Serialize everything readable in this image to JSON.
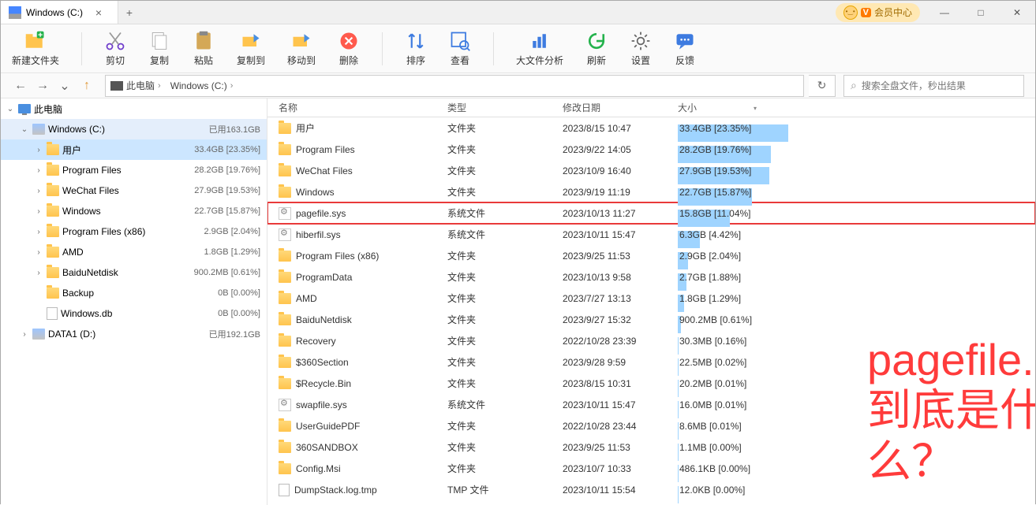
{
  "title": {
    "tab_label": "Windows (C:)"
  },
  "vip": {
    "text": "会员中心"
  },
  "toolbar": {
    "newfolder": "新建文件夹",
    "cut": "剪切",
    "copy": "复制",
    "paste": "粘贴",
    "copyto": "复制到",
    "moveto": "移动到",
    "delete": "删除",
    "sort": "排序",
    "view": "查看",
    "bigfile": "大文件分析",
    "refresh": "刷新",
    "settings": "设置",
    "feedback": "反馈"
  },
  "breadcrumb": {
    "root": "此电脑",
    "drive": "Windows (C:)"
  },
  "search": {
    "placeholder": "搜索全盘文件，秒出结果"
  },
  "tree": [
    {
      "level": 0,
      "chevron": "v",
      "icon": "pc",
      "label": "此电脑",
      "size": "",
      "sel": ""
    },
    {
      "level": 1,
      "chevron": "v",
      "icon": "drive",
      "label": "Windows (C:)",
      "size": "已用163.1GB",
      "sel": "alt"
    },
    {
      "level": 2,
      "chevron": ">",
      "icon": "folder",
      "label": "用户",
      "size": "33.4GB [23.35%]",
      "sel": "yes"
    },
    {
      "level": 2,
      "chevron": ">",
      "icon": "folder",
      "label": "Program Files",
      "size": "28.2GB [19.76%]",
      "sel": ""
    },
    {
      "level": 2,
      "chevron": ">",
      "icon": "folder",
      "label": "WeChat Files",
      "size": "27.9GB [19.53%]",
      "sel": ""
    },
    {
      "level": 2,
      "chevron": ">",
      "icon": "folder",
      "label": "Windows",
      "size": "22.7GB [15.87%]",
      "sel": ""
    },
    {
      "level": 2,
      "chevron": ">",
      "icon": "folder",
      "label": "Program Files (x86)",
      "size": "2.9GB [2.04%]",
      "sel": ""
    },
    {
      "level": 2,
      "chevron": ">",
      "icon": "folder",
      "label": "AMD",
      "size": "1.8GB [1.29%]",
      "sel": ""
    },
    {
      "level": 2,
      "chevron": ">",
      "icon": "folder",
      "label": "BaiduNetdisk",
      "size": "900.2MB [0.61%]",
      "sel": ""
    },
    {
      "level": 2,
      "chevron": "",
      "icon": "folder",
      "label": "Backup",
      "size": "0B [0.00%]",
      "sel": ""
    },
    {
      "level": 2,
      "chevron": "",
      "icon": "file",
      "label": "Windows.db",
      "size": "0B [0.00%]",
      "sel": ""
    },
    {
      "level": 1,
      "chevron": ">",
      "icon": "drive",
      "label": "DATA1 (D:)",
      "size": "已用192.1GB",
      "sel": ""
    }
  ],
  "columns": {
    "name": "名称",
    "type": "类型",
    "date": "修改日期",
    "size": "大小"
  },
  "files": [
    {
      "icon": "folder",
      "name": "用户",
      "type": "文件夹",
      "date": "2023/8/15 10:47",
      "size": "33.4GB [23.35%]",
      "bar": 100,
      "hl": false
    },
    {
      "icon": "folder",
      "name": "Program Files",
      "type": "文件夹",
      "date": "2023/9/22 14:05",
      "size": "28.2GB [19.76%]",
      "bar": 84,
      "hl": false
    },
    {
      "icon": "folder",
      "name": "WeChat Files",
      "type": "文件夹",
      "date": "2023/10/9 16:40",
      "size": "27.9GB [19.53%]",
      "bar": 83,
      "hl": false
    },
    {
      "icon": "folder",
      "name": "Windows",
      "type": "文件夹",
      "date": "2023/9/19 11:19",
      "size": "22.7GB [15.87%]",
      "bar": 67,
      "hl": false
    },
    {
      "icon": "sys",
      "name": "pagefile.sys",
      "type": "系统文件",
      "date": "2023/10/13 11:27",
      "size": "15.8GB [11.04%]",
      "bar": 47,
      "hl": true
    },
    {
      "icon": "sys",
      "name": "hiberfil.sys",
      "type": "系统文件",
      "date": "2023/10/11 15:47",
      "size": "6.3GB [4.42%]",
      "bar": 20,
      "hl": false
    },
    {
      "icon": "folder",
      "name": "Program Files (x86)",
      "type": "文件夹",
      "date": "2023/9/25 11:53",
      "size": "2.9GB [2.04%]",
      "bar": 9,
      "hl": false
    },
    {
      "icon": "folder",
      "name": "ProgramData",
      "type": "文件夹",
      "date": "2023/10/13 9:58",
      "size": "2.7GB [1.88%]",
      "bar": 8,
      "hl": false
    },
    {
      "icon": "folder",
      "name": "AMD",
      "type": "文件夹",
      "date": "2023/7/27 13:13",
      "size": "1.8GB [1.29%]",
      "bar": 6,
      "hl": false
    },
    {
      "icon": "folder",
      "name": "BaiduNetdisk",
      "type": "文件夹",
      "date": "2023/9/27 15:32",
      "size": "900.2MB [0.61%]",
      "bar": 3,
      "hl": false
    },
    {
      "icon": "folder",
      "name": "Recovery",
      "type": "文件夹",
      "date": "2022/10/28 23:39",
      "size": "30.3MB [0.16%]",
      "bar": 1,
      "hl": false
    },
    {
      "icon": "folder",
      "name": "$360Section",
      "type": "文件夹",
      "date": "2023/9/28 9:59",
      "size": "22.5MB [0.02%]",
      "bar": 1,
      "hl": false
    },
    {
      "icon": "folder",
      "name": "$Recycle.Bin",
      "type": "文件夹",
      "date": "2023/8/15 10:31",
      "size": "20.2MB [0.01%]",
      "bar": 1,
      "hl": false
    },
    {
      "icon": "sys",
      "name": "swapfile.sys",
      "type": "系统文件",
      "date": "2023/10/11 15:47",
      "size": "16.0MB [0.01%]",
      "bar": 1,
      "hl": false
    },
    {
      "icon": "folder",
      "name": "UserGuidePDF",
      "type": "文件夹",
      "date": "2022/10/28 23:44",
      "size": "8.6MB [0.01%]",
      "bar": 1,
      "hl": false
    },
    {
      "icon": "folder",
      "name": "360SANDBOX",
      "type": "文件夹",
      "date": "2023/9/25 11:53",
      "size": "1.1MB [0.00%]",
      "bar": 1,
      "hl": false
    },
    {
      "icon": "folder",
      "name": "Config.Msi",
      "type": "文件夹",
      "date": "2023/10/7 10:33",
      "size": "486.1KB [0.00%]",
      "bar": 1,
      "hl": false
    },
    {
      "icon": "file",
      "name": "DumpStack.log.tmp",
      "type": "TMP 文件",
      "date": "2023/10/11 15:54",
      "size": "12.0KB [0.00%]",
      "bar": 1,
      "hl": false
    }
  ],
  "overlay": {
    "line1": "pagefile.sys",
    "line2": "到底是什么？"
  }
}
